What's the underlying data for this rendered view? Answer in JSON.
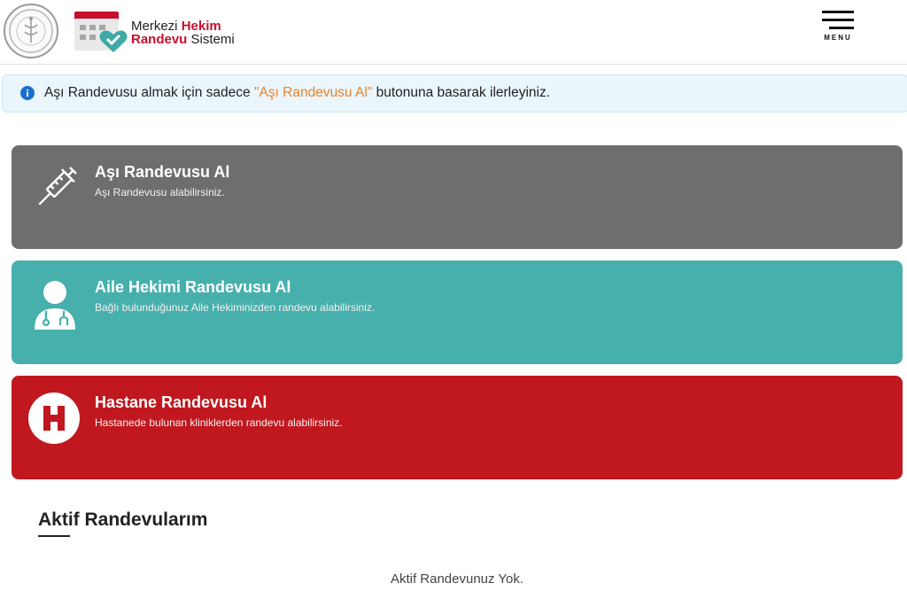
{
  "header": {
    "logo": {
      "line1_plain": "Merkezi",
      "line1_accent": "Hekim",
      "line2_accent": "Randevu",
      "line2_plain": "Sistemi"
    },
    "menu_label": "MENU"
  },
  "info": {
    "prefix": "Aşı Randevusu almak için sadece ",
    "highlight": "\"Aşı Randevusu Al\"",
    "suffix": " butonuna basarak ilerleyiniz."
  },
  "cards": [
    {
      "title": "Aşı Randevusu Al",
      "desc": "Aşı Randevusu alabilirsiniz.",
      "icon": "syringe-icon",
      "color": "#6e6e6e"
    },
    {
      "title": "Aile Hekimi Randevusu Al",
      "desc": "Bağlı bulunduğunuz Aile Hekiminizden randevu alabilirsiniz.",
      "icon": "doctor-icon",
      "color": "#47b0ad"
    },
    {
      "title": "Hastane Randevusu Al",
      "desc": "Hastanede bulunan kliniklerden randevu alabilirsiniz.",
      "icon": "hospital-h-icon",
      "color": "#c0181e"
    }
  ],
  "active": {
    "title": "Aktif Randevularım",
    "empty": "Aktif Randevunuz Yok."
  },
  "colors": {
    "accent_red": "#c8102e",
    "info_highlight": "#e8832f",
    "info_bg": "#eaf6fc"
  }
}
